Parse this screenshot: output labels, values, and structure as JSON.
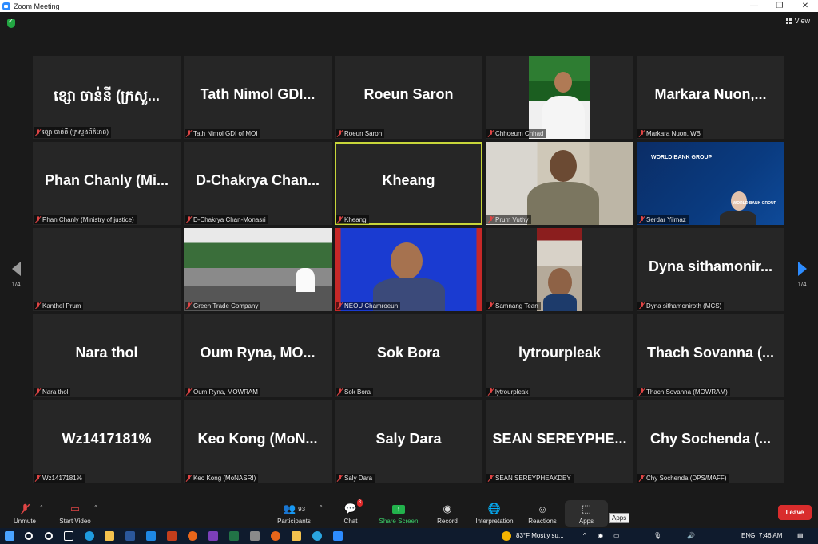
{
  "window": {
    "title": "Zoom Meeting",
    "minimize": "—",
    "restore": "❐",
    "close": "✕"
  },
  "header": {
    "view_label": "View"
  },
  "pager": {
    "left": "1/4",
    "right": "1/4"
  },
  "tiles": [
    {
      "big": "ខ្សោ ចាន់នី (ក្រសួ...",
      "label": "ខ្សោ ចាន់នី (ក្រសួងព័ត៌មាន)",
      "video": ""
    },
    {
      "big": "Tath Nimol GDI...",
      "label": "Tath Nimol GDI of MOI",
      "video": ""
    },
    {
      "big": "Roeun Saron",
      "label": "Roeun Saron",
      "video": ""
    },
    {
      "big": "",
      "label": "Chhoeum Chhad",
      "video": "chhoeum"
    },
    {
      "big": "Markara Nuon,...",
      "label": "Markara Nuon, WB",
      "video": ""
    },
    {
      "big": "Phan Chanly (Mi...",
      "label": "Phan Chanly (Ministry of justice)",
      "video": ""
    },
    {
      "big": "D-Chakrya Chan...",
      "label": "D-Chakrya Chan-Monasri",
      "video": ""
    },
    {
      "big": "Kheang",
      "label": "Kheang",
      "video": "",
      "active": true
    },
    {
      "big": "",
      "label": "Prum Vuthy",
      "video": "prum"
    },
    {
      "big": "",
      "label": "Serdar Yilmaz",
      "video": "serdar"
    },
    {
      "big": "",
      "label": "Kanthel Prum",
      "video": ""
    },
    {
      "big": "",
      "label": "Green Trade Company",
      "video": "green"
    },
    {
      "big": "",
      "label": "NEOU Chamroeun",
      "video": "neou"
    },
    {
      "big": "",
      "label": "Samnang Tean",
      "video": "samnang"
    },
    {
      "big": "Dyna sithamonir...",
      "label": "Dyna sithamoniroth (MCS)",
      "video": ""
    },
    {
      "big": "Nara thol",
      "label": "Nara thol",
      "video": ""
    },
    {
      "big": "Oum Ryna, MO...",
      "label": "Oum Ryna, MOWRAM",
      "video": ""
    },
    {
      "big": "Sok Bora",
      "label": "Sok Bora",
      "video": ""
    },
    {
      "big": "lytrourpleak",
      "label": "lytrourpleak",
      "video": ""
    },
    {
      "big": "Thach Sovanna (...",
      "label": "Thach Sovanna (MOWRAM)",
      "video": ""
    },
    {
      "big": "Wz1417181%",
      "label": "Wz1417181%",
      "video": ""
    },
    {
      "big": "Keo Kong (MoN...",
      "label": "Keo Kong (MoNASRI)",
      "video": ""
    },
    {
      "big": "Saly Dara",
      "label": "Saly Dara",
      "video": ""
    },
    {
      "big": "SEAN SEREYPHE...",
      "label": "SEAN SEREYPHEAKDEY",
      "video": ""
    },
    {
      "big": "Chy Sochenda (...",
      "label": "Chy Sochenda (DPS/MAFF)",
      "video": ""
    }
  ],
  "video_text": {
    "wb_logo": "WORLD BANK GROUP",
    "wb_logo2": "WORLD BANK GROUP"
  },
  "toolbar": {
    "unmute": "Unmute",
    "start_video": "Start Video",
    "participants": "Participants",
    "participants_count": "93",
    "chat": "Chat",
    "chat_badge": "8",
    "share_screen": "Share Screen",
    "record": "Record",
    "interpretation": "Interpretation",
    "reactions": "Reactions",
    "apps": "Apps",
    "apps_tooltip": "Apps",
    "leave": "Leave"
  },
  "taskbar": {
    "weather": "83°F  Mostly su...",
    "lang": "ENG",
    "time": "7:46 AM"
  },
  "colors": {
    "accent_blue": "#2d8cff",
    "leave_red": "#d92c2c",
    "share_green": "#22b24c",
    "active_speaker": "#c8d63a"
  }
}
